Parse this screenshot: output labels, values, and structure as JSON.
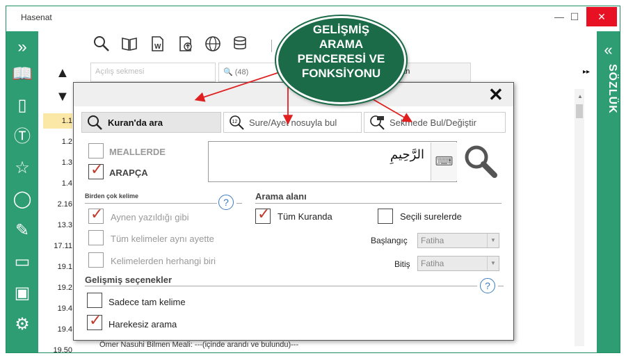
{
  "app": {
    "title": "Hasenat"
  },
  "window_controls": {
    "minimize": "—",
    "maximize": "☐",
    "close": "✕"
  },
  "toolbar": {
    "icons": [
      "search-icon",
      "book-open-icon",
      "word-doc-icon",
      "upload-icon",
      "globe-icon",
      "database-icon"
    ]
  },
  "search_bar": {
    "placeholder": "Açılış sekmesi",
    "count_hint": "(48)",
    "tab_suffix": "mân",
    "more": "▸▸"
  },
  "rows": [
    "1.1",
    "1.2",
    "1.3",
    "1.4",
    "2.16",
    "13.3",
    "17.11",
    "19.1",
    "19.2",
    "19.4",
    "19.4",
    "19.50"
  ],
  "bottom_text": "Ömer Nasuhi Bilmen Meali: ---(içinde arandı ve bulundu)---",
  "right_panel": {
    "label": "SÖZLÜK"
  },
  "callout": {
    "text_lines": [
      "GELİŞMİŞ",
      "ARAMA",
      "PENCERESİ VE",
      "FONKSİYONU"
    ]
  },
  "dialog": {
    "close": "✕",
    "tabs": [
      "Kuran'da ara",
      "Sure/Ayet nosuyla bul",
      "Sekmede Bul/Değiştir"
    ],
    "search_options": {
      "meallerde": "MEALLERDE",
      "arapca": "ARAPÇA",
      "meallerde_checked": false,
      "arapca_checked": true
    },
    "search_text": "الرَّحِيمِ",
    "multi_word": {
      "title": "Birden çok kelime",
      "options": [
        {
          "label": "Aynen yazıldığı gibi",
          "checked": true
        },
        {
          "label": "Tüm kelimeler aynı ayette",
          "checked": false
        },
        {
          "label": "Kelimelerden herhangi biri",
          "checked": false
        }
      ]
    },
    "area": {
      "title": "Arama alanı",
      "all_quran": "Tüm Kuranda",
      "all_quran_checked": true,
      "selected_surahs": "Seçili surelerde",
      "selected_checked": false,
      "start_label": "Başlangıç",
      "start_value": "Fatiha",
      "end_label": "Bitiş",
      "end_value": "Fatiha"
    },
    "advanced": {
      "title": "Gelişmiş seçenekler",
      "options": [
        {
          "label": "Sadece tam kelime",
          "checked": false
        },
        {
          "label": "Harekesiz arama",
          "checked": true
        }
      ]
    },
    "help": "?"
  },
  "colors": {
    "accent_green": "#2e9d74",
    "callout_green": "#1b6b49",
    "check_red": "#c0392b",
    "arrow_red": "#e02020"
  }
}
